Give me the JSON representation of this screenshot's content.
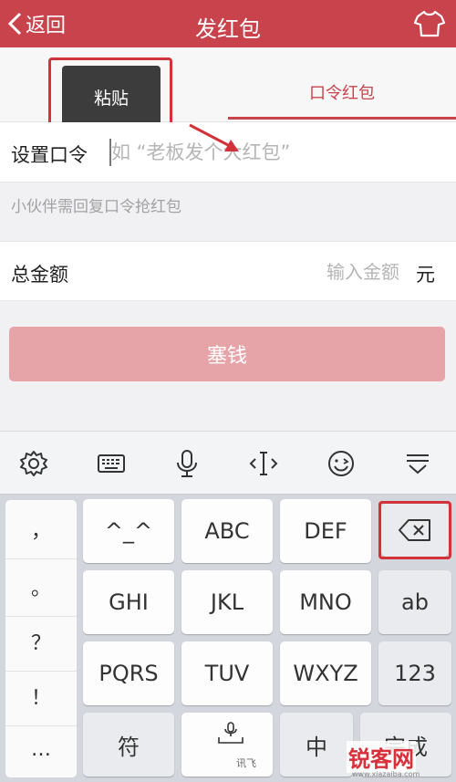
{
  "nav": {
    "back_label": "返回",
    "title": "发红包"
  },
  "tabs": {
    "right_label": "口令红包"
  },
  "paste": {
    "label": "粘贴"
  },
  "code_row": {
    "label": "设置口令",
    "placeholder": "如 “老板发个大红包”"
  },
  "hint": "小伙伴需回复口令抢红包",
  "amount_row": {
    "label": "总金额",
    "placeholder": "输入金额",
    "unit": "元"
  },
  "submit_label": "塞钱",
  "toolbar": {
    "icons": [
      "settings-icon",
      "keyboard-icon",
      "microphone-icon",
      "cursor-icon",
      "emoji-icon",
      "hide-keyboard-icon"
    ]
  },
  "keyboard": {
    "punctuation": [
      "，",
      "。",
      "？",
      "！",
      "…"
    ],
    "keys": {
      "k1": "^_^",
      "k2": "ABC",
      "k3": "DEF",
      "k4": "GHI",
      "k5": "JKL",
      "k6": "MNO",
      "ab": "ab",
      "k7": "PQRS",
      "k8": "TUV",
      "k9": "WXYZ",
      "num": "123",
      "symbol": "符",
      "space_label": "讯飞",
      "lang": "中",
      "done": "完成"
    }
  },
  "watermark": {
    "text": "锐客网",
    "sub": "www.xiazaiba.com"
  },
  "colors": {
    "brand": "#c9434c",
    "highlight": "#d2323a",
    "button_disabled": "#e6a4a8"
  }
}
